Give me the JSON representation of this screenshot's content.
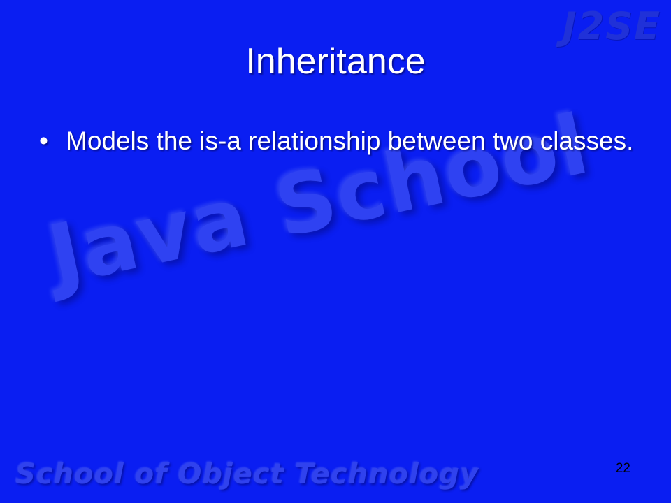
{
  "slide": {
    "title": "Inheritance",
    "bullets": [
      {
        "marker": "•",
        "text": "Models the is-a relationship between two classes."
      }
    ],
    "page_number": "22"
  },
  "watermarks": {
    "corner_logo": "J2SE",
    "center_logo": "Java School",
    "footer_logo": "School of Object Technology"
  },
  "colors": {
    "background": "#0a1ef2",
    "text": "#ffffff",
    "page_number": "#000000"
  }
}
